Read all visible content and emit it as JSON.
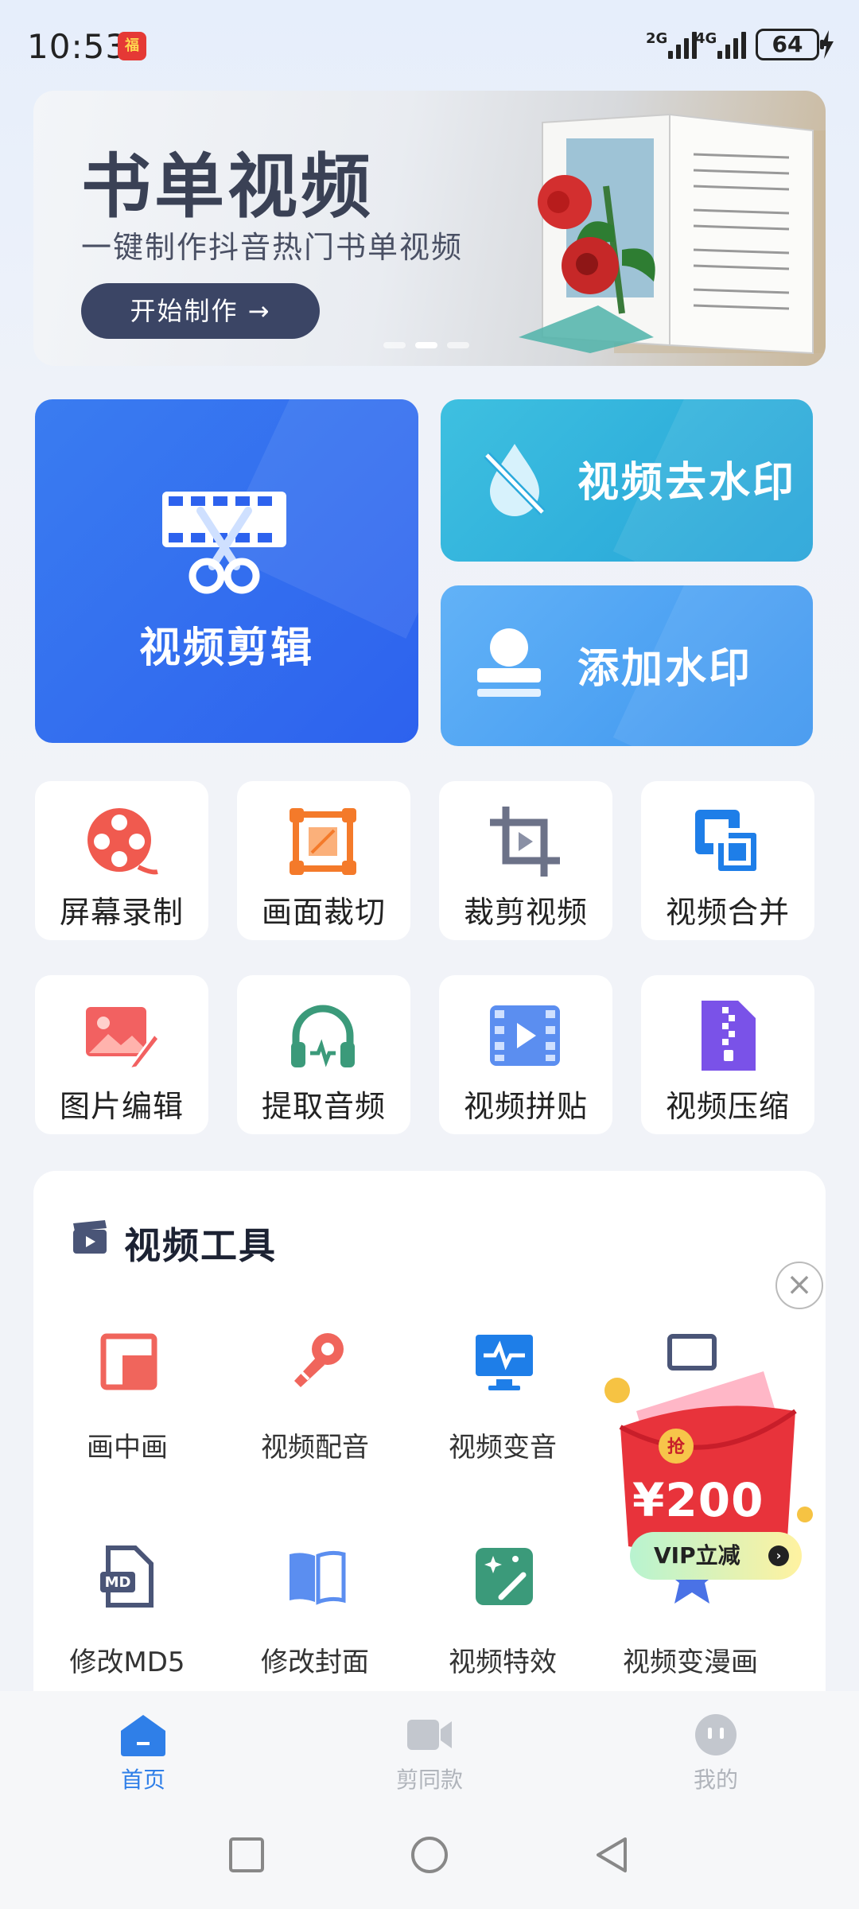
{
  "status_bar": {
    "time": "10:53",
    "net1": "2G",
    "net2": "4G",
    "battery": "64"
  },
  "banner": {
    "title": "书单视频",
    "subtitle": "一键制作抖音热门书单视频",
    "button": "开始制作 →"
  },
  "tiles": {
    "edit": "视频剪辑",
    "remove_watermark": "视频去水印",
    "add_watermark": "添加水印"
  },
  "grid_row1": [
    {
      "label": "屏幕录制",
      "icon": "screen-record-icon"
    },
    {
      "label": "画面裁切",
      "icon": "frame-crop-icon"
    },
    {
      "label": "裁剪视频",
      "icon": "crop-video-icon"
    },
    {
      "label": "视频合并",
      "icon": "merge-video-icon"
    }
  ],
  "grid_row2": [
    {
      "label": "图片编辑",
      "icon": "image-edit-icon"
    },
    {
      "label": "提取音频",
      "icon": "extract-audio-icon"
    },
    {
      "label": "视频拼贴",
      "icon": "video-collage-icon"
    },
    {
      "label": "视频压缩",
      "icon": "video-compress-icon"
    }
  ],
  "tools_panel": {
    "title": "视频工具",
    "row1": [
      {
        "label": "画中画",
        "icon": "picture-in-picture-icon"
      },
      {
        "label": "视频配音",
        "icon": "microphone-icon"
      },
      {
        "label": "视频变音",
        "icon": "voice-change-icon"
      },
      {
        "label": "",
        "icon": "hidden-tool-icon"
      }
    ],
    "row2": [
      {
        "label": "修改MD5",
        "icon": "md5-file-icon"
      },
      {
        "label": "修改封面",
        "icon": "cover-book-icon"
      },
      {
        "label": "视频特效",
        "icon": "effects-icon"
      },
      {
        "label": "视频变漫画",
        "icon": "comic-icon"
      }
    ]
  },
  "promo": {
    "price": "¥200",
    "vip_label": "VIP立减",
    "badge": "抢"
  },
  "bottom_nav": {
    "home": "首页",
    "templates": "剪同款",
    "mine": "我的"
  },
  "colors": {
    "accent": "#2f7fe8",
    "tile_edit": "#2d62ee",
    "tile_watermark": "#25a3d8",
    "tile_add": "#3d95ef"
  }
}
